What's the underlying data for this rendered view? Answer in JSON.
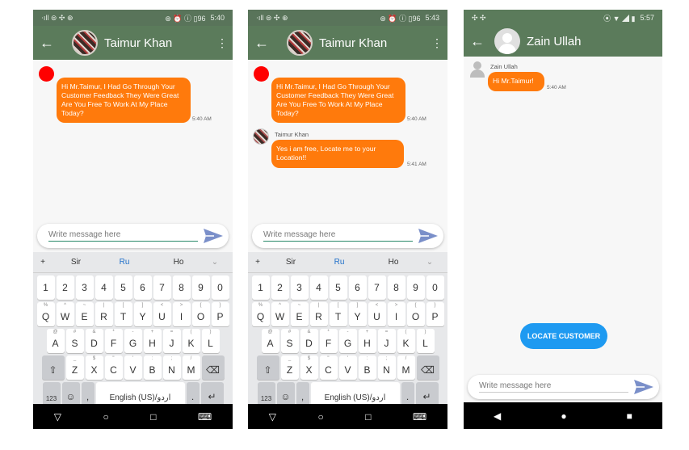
{
  "phones": [
    {
      "status": {
        "time": "5:40",
        "left_icons": "⋅ıll ⊜ ✣ ⊕",
        "right_icons": "⊛ ⏰ ⓘ ▯96"
      },
      "header": {
        "title": "Taimur Khan"
      },
      "messages": {
        "m1": {
          "text": "Hi  Mr.Taimur, I Had Go Through Your Customer Feedback They Were Great Are You Free To Work At My Place Today?",
          "time": "5:40 AM"
        }
      },
      "input": {
        "placeholder": "Write message here"
      },
      "keyboard": {
        "suggestions": [
          "+",
          "Sir",
          "Ru",
          "Ho",
          "⌄"
        ],
        "space": "English (US)/اردو"
      }
    },
    {
      "status": {
        "time": "5:43",
        "left_icons": "⋅ıll ⊜ ✣ ⊕",
        "right_icons": "⊛ ⏰ ⓘ ▯96"
      },
      "header": {
        "title": "Taimur Khan"
      },
      "messages": {
        "m1": {
          "text": "Hi  Mr.Taimur, I Had Go Through Your Customer Feedback They Were Great Are You Free To Work At My Place Today?",
          "time": "5:40 AM"
        },
        "m2": {
          "sender": "Taimur Khan",
          "text": "Yes i am free, Locate me to your Location!!",
          "time": "5:41 AM"
        }
      },
      "input": {
        "placeholder": "Write message here"
      },
      "keyboard": {
        "suggestions": [
          "+",
          "Sir",
          "Ru",
          "Ho",
          "⌄"
        ],
        "space": "English (US)/اردو"
      }
    },
    {
      "status": {
        "time": "5:57"
      },
      "header": {
        "title": "Zain Ullah"
      },
      "messages": {
        "m1": {
          "sender": "Zain Ullah",
          "text": "Hi  Mr.Taimur!",
          "time": "5:40 AM"
        }
      },
      "locate_button": "LOCATE CUSTOMER",
      "input": {
        "placeholder": "Write message here"
      }
    }
  ],
  "keys": {
    "numbers": [
      "1",
      "2",
      "3",
      "4",
      "5",
      "6",
      "7",
      "8",
      "9",
      "0"
    ],
    "row1": [
      [
        "%",
        "Q"
      ],
      [
        "^",
        "W"
      ],
      [
        "~",
        "E"
      ],
      [
        "|",
        "R"
      ],
      [
        "[",
        "T"
      ],
      [
        "]",
        "Y"
      ],
      [
        "<",
        "U"
      ],
      [
        ">",
        "I"
      ],
      [
        "{",
        "O"
      ],
      [
        "}",
        "P"
      ]
    ],
    "row2": [
      [
        "@",
        "A"
      ],
      [
        "#",
        "S"
      ],
      [
        "&",
        "D"
      ],
      [
        "*",
        "F"
      ],
      [
        "-",
        "G"
      ],
      [
        "+",
        "H"
      ],
      [
        "=",
        "J"
      ],
      [
        "(",
        "K"
      ],
      [
        ")",
        "L"
      ]
    ],
    "row3": [
      [
        "_",
        "Z"
      ],
      [
        "$",
        "X"
      ],
      [
        "\"",
        "C"
      ],
      [
        "'",
        "V"
      ],
      [
        ":",
        "B"
      ],
      [
        ";",
        "N"
      ],
      [
        "/",
        "M"
      ]
    ],
    "bottom_left": "123"
  },
  "colors": {
    "appbar": "#5b7b5b",
    "bubble": "#ff7a0c",
    "accent_blue": "#1e9af1",
    "send": "#7a8fc9"
  }
}
